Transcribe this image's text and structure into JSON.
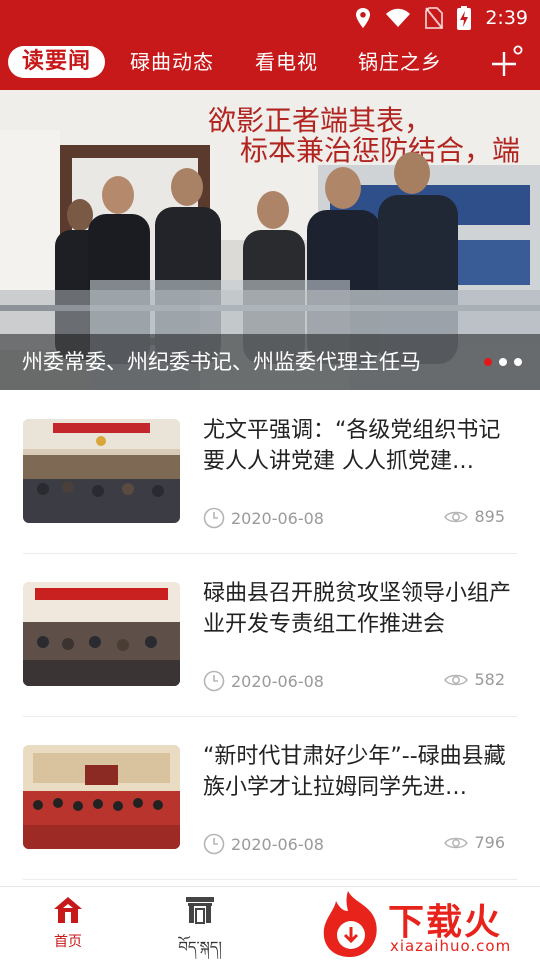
{
  "status_bar": {
    "time": "2:39",
    "icons": [
      "location-icon",
      "wifi-icon",
      "no-sim-icon",
      "battery-charging-icon"
    ]
  },
  "topnav": {
    "tabs": [
      {
        "label": "读要闻",
        "active": true
      },
      {
        "label": "碌曲动态",
        "active": false
      },
      {
        "label": "看电视",
        "active": false
      },
      {
        "label": "锅庄之乡",
        "active": false
      }
    ],
    "plus_icon": "plus-icon"
  },
  "banner": {
    "caption": "州委常委、州纪委书记、州监委代理主任马",
    "slogan_line1": "欲影正者端其表，",
    "slogan_line2": "标本兼治惩防结合，端",
    "dots": {
      "count": 3,
      "active_index": 0
    }
  },
  "news": [
    {
      "title": "尤文平强调：“各级党组织书记要人人讲党建 人人抓党建…",
      "date": "2020-06-08",
      "views": "895"
    },
    {
      "title": "碌曲县召开脱贫攻坚领导小组产业开发专责组工作推进会",
      "date": "2020-06-08",
      "views": "582"
    },
    {
      "title": "“新时代甘肃好少年”--碌曲县藏族小学才让拉姆同学先进…",
      "date": "2020-06-08",
      "views": "796"
    }
  ],
  "bottom_nav": {
    "home_label": "首页",
    "tibetan_label": "བོད་སྐད།"
  },
  "watermark": {
    "brand": "下载火",
    "url": "xiazaihuo.com"
  },
  "colors": {
    "brand_red": "#c8191a",
    "meta_gray": "#9a9a9a"
  }
}
